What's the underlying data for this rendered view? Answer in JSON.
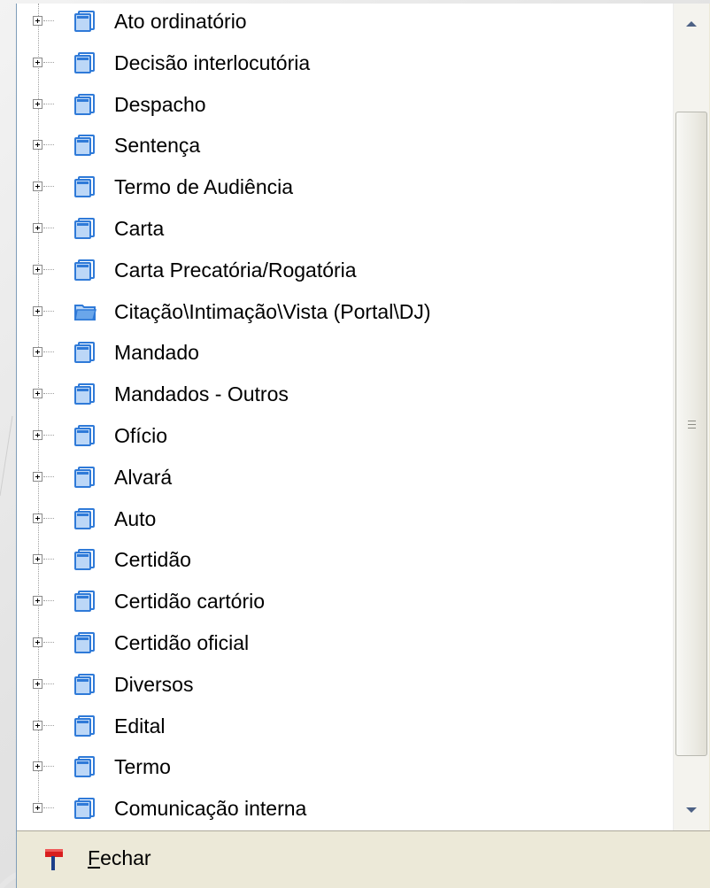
{
  "tree": {
    "items": [
      {
        "label": "Ato ordinatório",
        "icon": "document-folder-icon"
      },
      {
        "label": "Decisão interlocutória",
        "icon": "document-folder-icon"
      },
      {
        "label": "Despacho",
        "icon": "document-folder-icon"
      },
      {
        "label": "Sentença",
        "icon": "document-folder-icon"
      },
      {
        "label": "Termo de Audiência",
        "icon": "document-folder-icon"
      },
      {
        "label": "Carta",
        "icon": "document-folder-icon"
      },
      {
        "label": "Carta Precatória/Rogatória",
        "icon": "document-folder-icon"
      },
      {
        "label": "Citação\\Intimação\\Vista (Portal\\DJ)",
        "icon": "open-folder-icon"
      },
      {
        "label": "Mandado",
        "icon": "document-folder-icon"
      },
      {
        "label": "Mandados - Outros",
        "icon": "document-folder-icon"
      },
      {
        "label": "Ofício",
        "icon": "document-folder-icon"
      },
      {
        "label": "Alvará",
        "icon": "document-folder-icon"
      },
      {
        "label": "Auto",
        "icon": "document-folder-icon"
      },
      {
        "label": "Certidão",
        "icon": "document-folder-icon"
      },
      {
        "label": "Certidão cartório",
        "icon": "document-folder-icon"
      },
      {
        "label": "Certidão oficial",
        "icon": "document-folder-icon"
      },
      {
        "label": "Diversos",
        "icon": "document-folder-icon"
      },
      {
        "label": "Edital",
        "icon": "document-folder-icon"
      },
      {
        "label": "Termo",
        "icon": "document-folder-icon"
      },
      {
        "label": "Comunicação interna",
        "icon": "document-folder-icon"
      }
    ]
  },
  "footer": {
    "close_label_first": "F",
    "close_label_rest": "echar",
    "close_icon": "red-flag-icon"
  },
  "colors": {
    "panel_background": "#ece9d8",
    "tree_background": "#ffffff",
    "folder_blue": "#2f7ad8",
    "flag_red": "#d81e1e"
  }
}
